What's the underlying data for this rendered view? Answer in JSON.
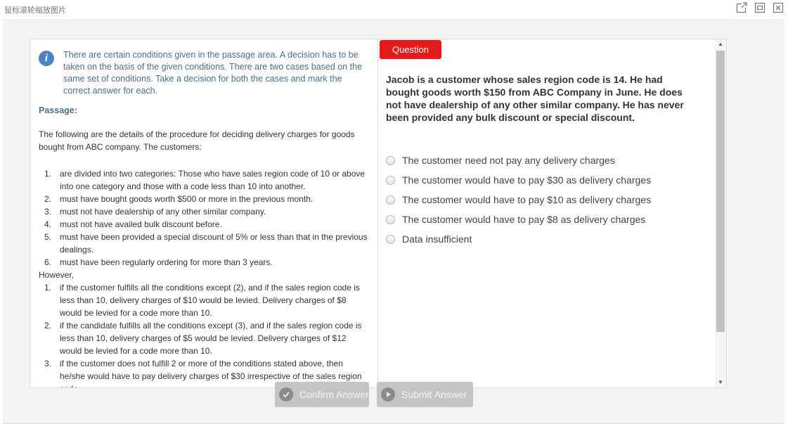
{
  "window": {
    "title": "鼠标滚轮缩放图片",
    "icons": [
      "external-link-icon",
      "minimize-icon",
      "close-icon"
    ]
  },
  "info": {
    "icon": "info-icon",
    "text": "There are certain conditions given in the passage area. A decision has to be taken on the basis of the given conditions. There are two cases based on the same set of conditions. Take a decision for both the cases and mark the correct answer for each."
  },
  "passage": {
    "label": "Passage:",
    "intro": "The following are the details of the procedure for deciding delivery charges for goods bought from ABC company. The customers:",
    "conditions": [
      {
        "num": "1.",
        "text": "are divided into two categories: Those who have sales region code of 10 or above into one category and those with a code less than 10 into another."
      },
      {
        "num": "2.",
        "text": "must have bought goods worth $500 or more in the previous month."
      },
      {
        "num": "3.",
        "text": "must not have dealership of any other similar company."
      },
      {
        "num": "4.",
        "text": "must not have availed bulk discount before."
      },
      {
        "num": "5.",
        "text": "must have been provided a special discount of 5% or less than that in the previous dealings."
      },
      {
        "num": "6.",
        "text": "must have been regularly ordering for more than 3 years."
      }
    ],
    "however_label": "However,",
    "exceptions": [
      {
        "num": "1.",
        "text": "if the customer fulfills all the conditions except (2), and if the sales region code is less than 10, delivery charges of $10 would be levied. Delivery charges of $8 would be levied for a code more than 10."
      },
      {
        "num": "2.",
        "text": "if the candidate fulfills all the conditions except (3), and if the sales region code is less than 10, delivery charges of $5 would be levied. Delivery charges of $12 would be levied for a code more than 10."
      },
      {
        "num": "3.",
        "text": "if the customer does not fulfill 2 or more of the conditions stated above, then he/she would have to pay delivery charges of $30 irrespective of the sales region code."
      }
    ]
  },
  "question": {
    "badge": "Question",
    "badge_color": "#e31b1b",
    "text": "Jacob is a customer whose sales region code is 14. He had bought goods worth $150 from ABC Company in June. He does not have dealership of any other similar company. He has never been provided any bulk discount or special discount.",
    "options": [
      "The customer need not pay any delivery charges",
      "The customer would have to pay $30 as delivery charges",
      "The customer would have to pay $10 as delivery charges",
      "The customer would have to pay $8 as delivery charges",
      "Data insufficient"
    ]
  },
  "buttons": {
    "confirm": {
      "label": "Confirm Answer",
      "icon": "check-circle-icon"
    },
    "submit": {
      "label": "Submit Answer",
      "icon": "play-circle-icon"
    }
  }
}
